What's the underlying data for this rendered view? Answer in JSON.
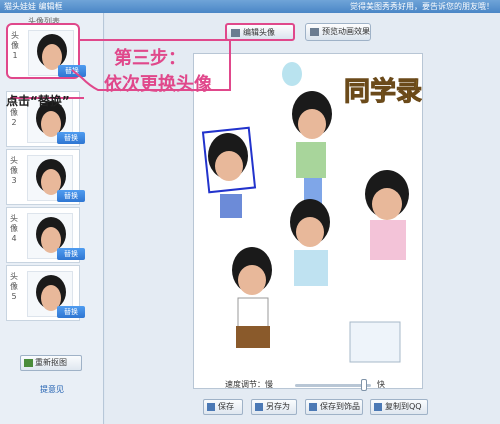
{
  "titlebar": {
    "title": "猫头娃娃  编辑框",
    "right": "觉得美图秀秀好用，要告诉您的朋友哦！"
  },
  "sidebar": {
    "header": "头像列表",
    "slots": [
      {
        "label": "头像1",
        "replace": "替换"
      },
      {
        "label": "头像2",
        "replace": "替换"
      },
      {
        "label": "头像3",
        "replace": "替换"
      },
      {
        "label": "头像4",
        "replace": "替换"
      },
      {
        "label": "头像5",
        "replace": "替换"
      }
    ],
    "recapture": "重新抠图",
    "feedback": "提意见"
  },
  "tabs": {
    "edit": "编辑头像",
    "preview": "预览动画效果"
  },
  "canvas": {
    "banner": "同学录"
  },
  "speed": {
    "label": "速度调节：慢",
    "fast": "快"
  },
  "actions": {
    "save": "保存",
    "save_as": "另存为",
    "save_to_accessory": "保存到饰品",
    "copy_qq": "复制到QQ"
  },
  "annotations": {
    "step_line1": "第三步：",
    "step_line2": "依次更换头像",
    "click_hint": "点击“替换”"
  },
  "colors": {
    "highlight": "#e0488b",
    "accent": "#2f76d2"
  }
}
